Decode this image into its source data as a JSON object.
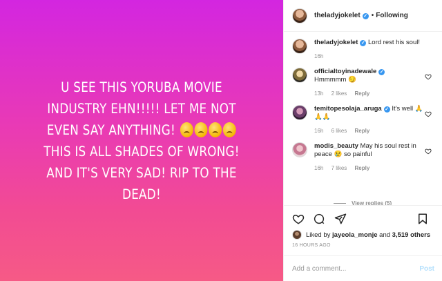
{
  "post": {
    "text": "U SEE THIS YORUBA MOVIE INDUSTRY EHN!!!!! LET ME NOT EVEN SAY ANYTHING! ",
    "text_after": "THIS IS ALL SHADES OF WRONG! AND IT'S VERY SAD! RIP TO THE DEAD!",
    "emoji": "crying-face-emoji",
    "gradient_top": "#d326e0",
    "gradient_bottom": "#f65a86"
  },
  "header": {
    "username": "theladyjokelet",
    "separator": "•",
    "follow_status": "Following"
  },
  "comments": [
    {
      "username": "theladyjokelet",
      "text": "Lord rest his soul!",
      "time": "16h",
      "likes": "",
      "reply": ""
    },
    {
      "username": "officialtoyinadewale",
      "text": "Hmmmmm 😏",
      "time": "13h",
      "likes": "2 likes",
      "reply": "Reply"
    },
    {
      "username": "temitopesolaja_aruga",
      "text": "It's well 🙏🙏🙏",
      "time": "16h",
      "likes": "6 likes",
      "reply": "Reply"
    },
    {
      "username": "modis_beauty",
      "text": "May his soul rest in peace 😢 so painful",
      "time": "16h",
      "likes": "7 likes",
      "reply": "Reply"
    }
  ],
  "view_replies": "View replies (5)",
  "likes": {
    "prefix": "Liked by",
    "user": "jayeola_monje",
    "joiner": "and",
    "others": "3,519 others"
  },
  "timestamp": "16 HOURS AGO",
  "composer": {
    "placeholder": "Add a comment...",
    "post_label": "Post"
  },
  "colors": {
    "verified": "#3897f0",
    "post_button_disabled": "#b2dffc"
  }
}
